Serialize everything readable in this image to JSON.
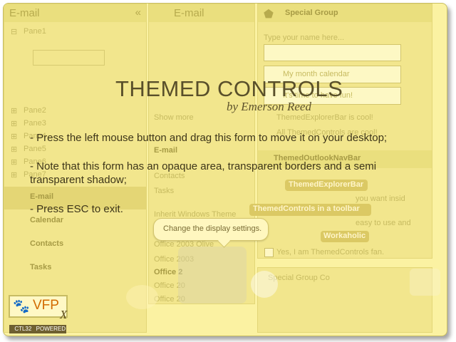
{
  "left_bar": {
    "title": "E-mail",
    "collapse_label": "«",
    "panes": [
      "Pane1",
      "Pane2",
      "Pane3",
      "Pane4",
      "Pane5",
      "Pane6",
      "Pane7"
    ],
    "nav": [
      "E-mail",
      "Calendar",
      "Contacts",
      "Tasks"
    ]
  },
  "middle_bar": {
    "title": "E-mail",
    "items": [
      "Show more",
      "E-mail",
      "Contacts",
      "Tasks"
    ],
    "menu": [
      "Inherit Windows Theme",
      "Office 2003 Olive",
      "Office 2003",
      "Office 2",
      "Office 20",
      "Office 20"
    ]
  },
  "right_bar": {
    "special_group_label": "Special Group",
    "name_placeholder": "Type your name here...",
    "calendar_option": "My month calendar",
    "fun_option": "It's time to have fun!",
    "explorer_radio": "ThemedExplorerBar is cool!",
    "all_controls_radio": "All ThemedControls are cool!",
    "outlook_header": "ThemedOutlookNavBar",
    "workaholic_label": "Workaholic",
    "explorerbar_label": "ThemedExplorerBar",
    "toolbar_label": "ThemedControls in a toolbar",
    "checkbox_label": "Yes, I am ThemedControls fan.",
    "special_group_container": "Special Group Co",
    "body_fragments": [
      "you want insid",
      "easy to use and"
    ]
  },
  "overlay": {
    "title": "THEMED CONTROLS",
    "author": "by Emerson Reed",
    "instructions": [
      "- Press the left mouse button and drag this form to move it on your desktop;",
      "- Note that this form has an opaque area, transparent borders and a semi transparent shadow;",
      "- Press ESC to exit."
    ],
    "tooltip": "Change the display settings."
  },
  "logo": {
    "brand": "VFP",
    "x": "X",
    "bottom": [
      "CTL32",
      "POWERED"
    ]
  }
}
